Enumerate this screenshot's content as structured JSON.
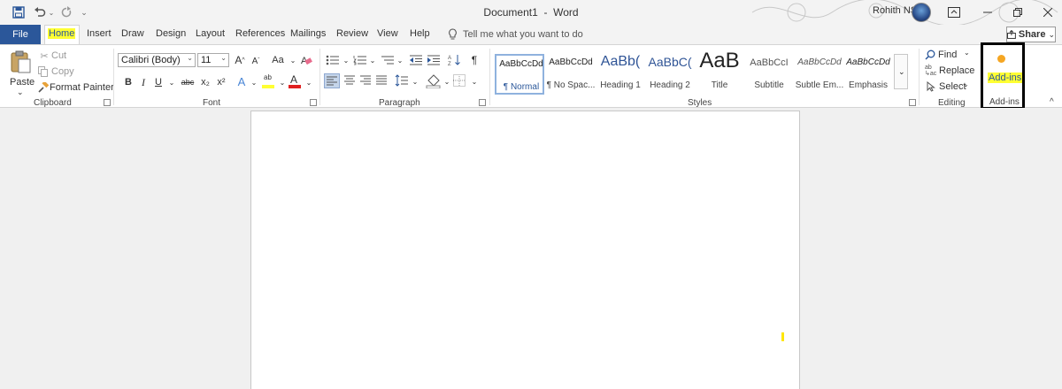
{
  "titlebar": {
    "title": "Document1",
    "separator": "-",
    "app": "Word",
    "user": "Rohith NS",
    "qat": [
      "save-icon",
      "undo-icon",
      "redo-icon",
      "customize-icon"
    ]
  },
  "tabs": {
    "file": "File",
    "items": [
      "Home",
      "Insert",
      "Draw",
      "Design",
      "Layout",
      "References",
      "Mailings",
      "Review",
      "View",
      "Help"
    ],
    "tell_me": "Tell me what you want to do",
    "share": "Share"
  },
  "clipboard": {
    "paste": "Paste",
    "cut": "Cut",
    "copy": "Copy",
    "format_painter": "Format Painter",
    "label": "Clipboard"
  },
  "font": {
    "name": "Calibri (Body)",
    "size": "11",
    "change_case": "Aa",
    "bold": "B",
    "italic": "I",
    "underline": "U",
    "strike": "abc",
    "subscript": "x₂",
    "superscript": "x²",
    "highlight_text": "ab",
    "font_color_text": "A",
    "label": "Font"
  },
  "paragraph": {
    "label": "Paragraph"
  },
  "styles": {
    "items": [
      {
        "preview": "AaBbCcDd",
        "name": "¶ Normal"
      },
      {
        "preview": "AaBbCcDd",
        "name": "¶ No Spac..."
      },
      {
        "preview": "AaBb(",
        "name": "Heading 1"
      },
      {
        "preview": "AaBbC(",
        "name": "Heading 2"
      },
      {
        "preview": "AaB",
        "name": "Title"
      },
      {
        "preview": "AaBbCcI",
        "name": "Subtitle"
      },
      {
        "preview": "AaBbCcDd",
        "name": "Subtle Em..."
      },
      {
        "preview": "AaBbCcDd",
        "name": "Emphasis"
      }
    ],
    "label": "Styles"
  },
  "editing": {
    "find": "Find",
    "replace": "Replace",
    "select": "Select",
    "label": "Editing"
  },
  "addins": {
    "button": "Add-ins",
    "label": "Add-ins"
  },
  "colors": {
    "file_tab": "#2b579a",
    "highlight": "#ffff33",
    "addins_dot": "#f5a623",
    "heading_blue": "#2f5496"
  }
}
